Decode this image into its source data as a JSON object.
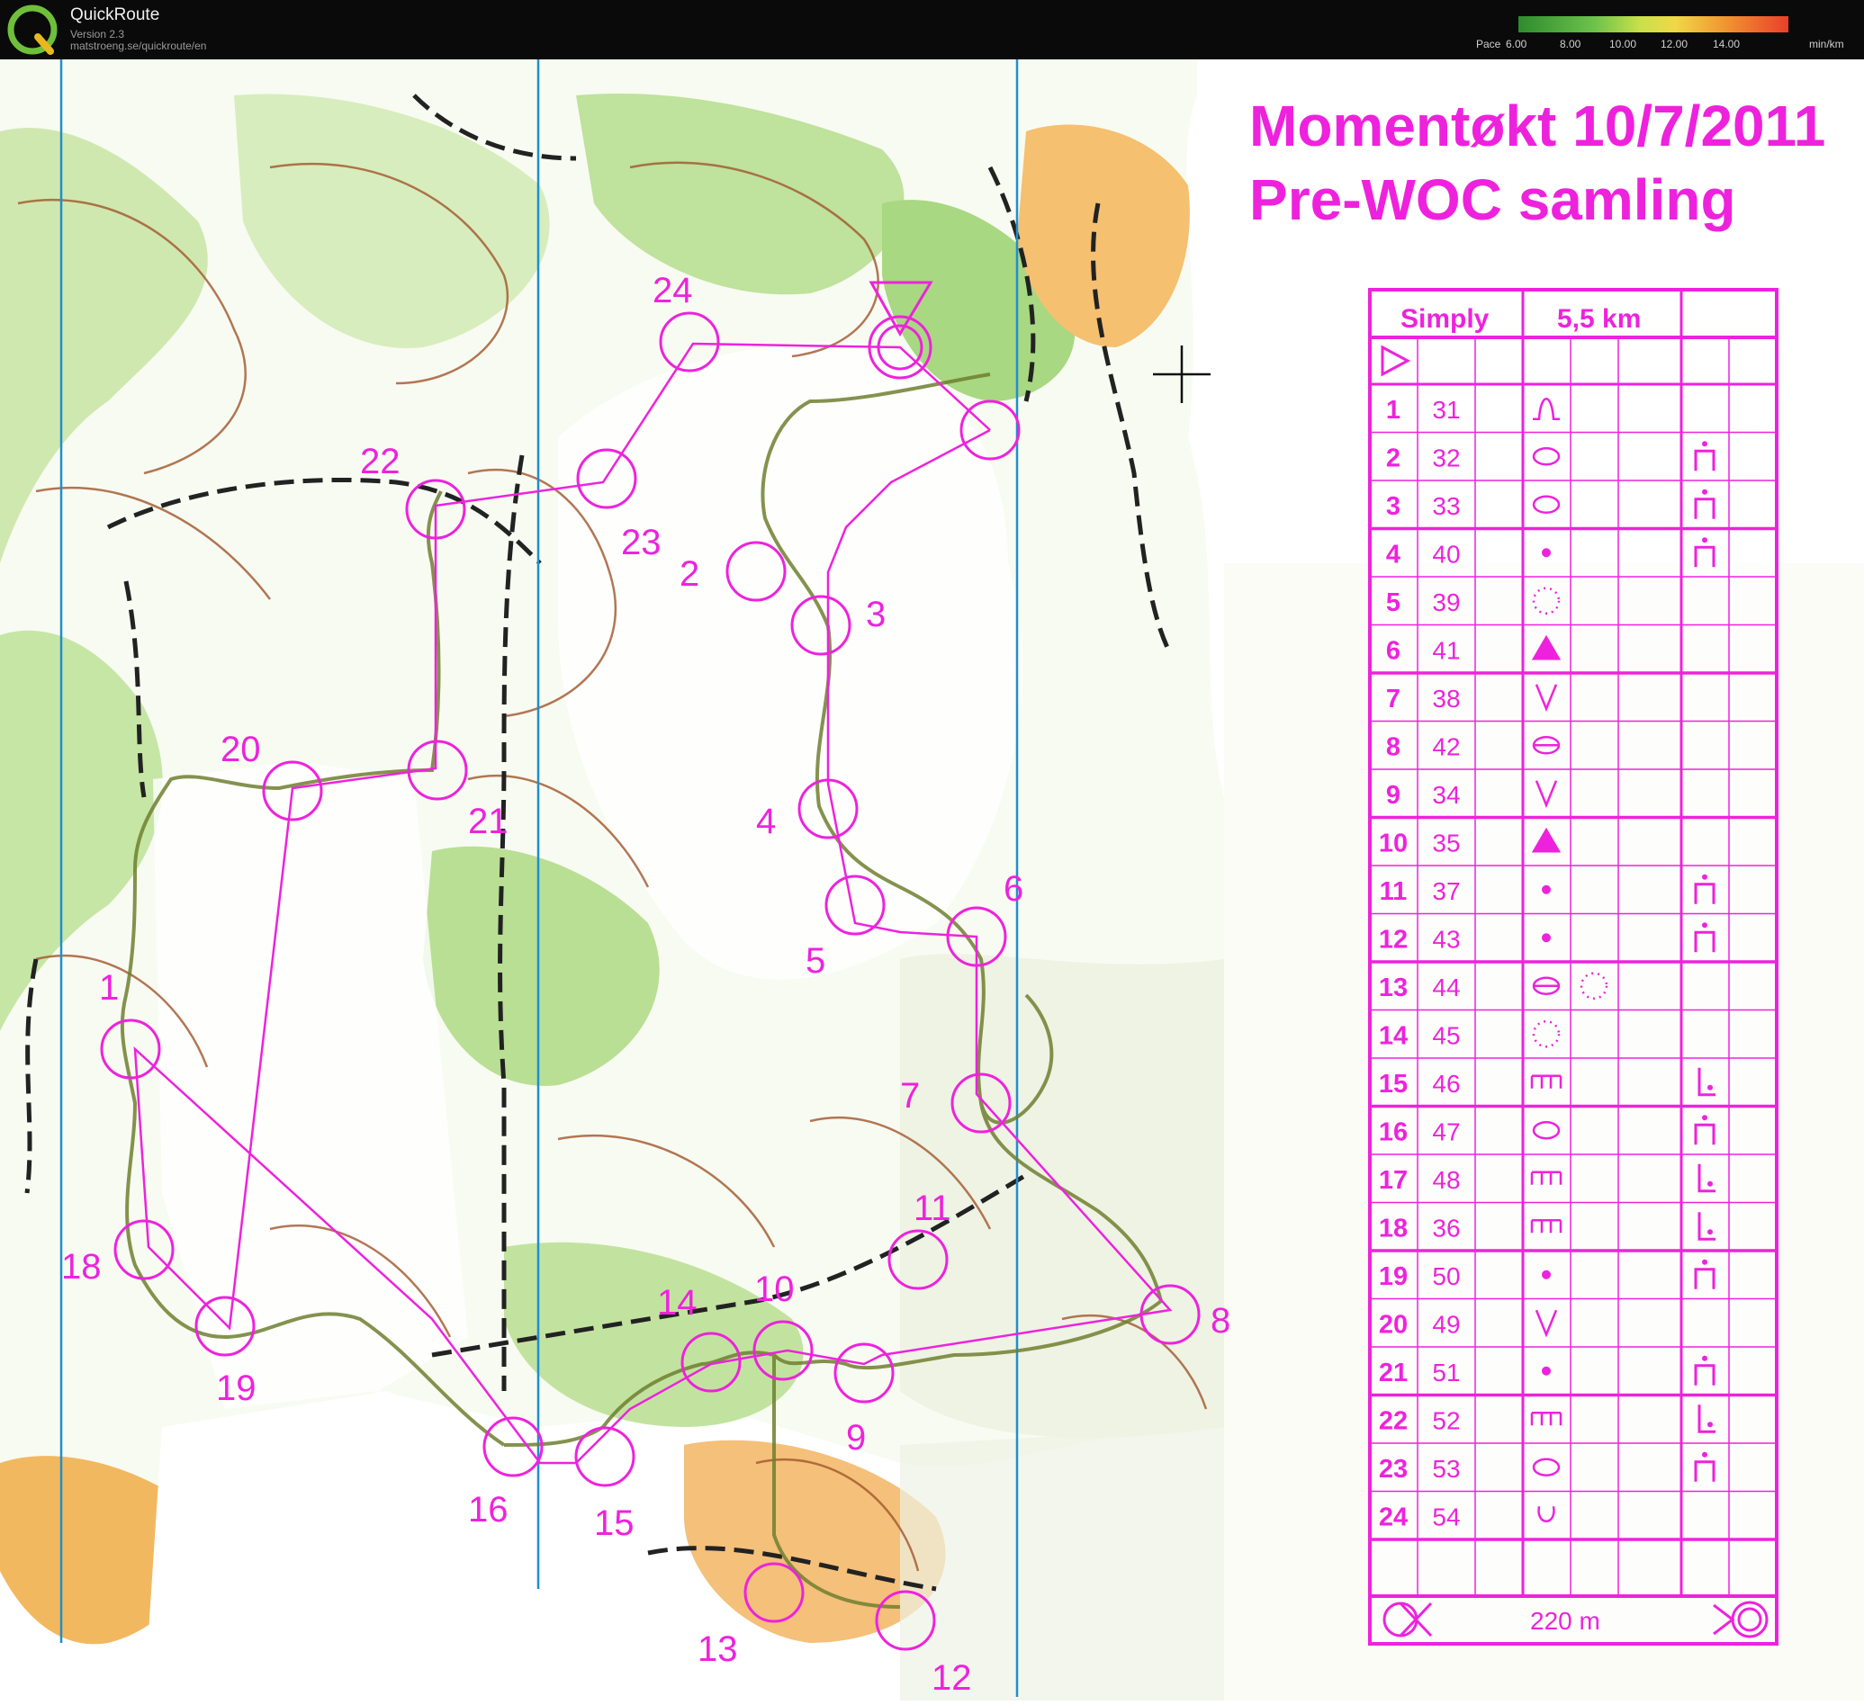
{
  "app": {
    "name": "QuickRoute",
    "version": "Version 2.3",
    "url": "matstroeng.se/quickroute/en",
    "pace_label": "Pace",
    "pace_ticks": [
      "6.00",
      "8.00",
      "10.00",
      "12.00",
      "14.00"
    ],
    "pace_unit": "min/km",
    "pace_colors": [
      "#2e8b2e",
      "#6cc24a",
      "#c8e04a",
      "#f0d848",
      "#f09030",
      "#e8402a"
    ]
  },
  "map": {
    "title_line1": "Momentøkt 10/7/2011",
    "title_line2": "Pre-WOC samling",
    "course_color": "#ee22dd",
    "route_color": "#7a8a3a",
    "meridian_color": "#1d8fd0",
    "controls": [
      {
        "num": "1"
      },
      {
        "num": "2"
      },
      {
        "num": "3"
      },
      {
        "num": "4"
      },
      {
        "num": "5"
      },
      {
        "num": "6"
      },
      {
        "num": "7"
      },
      {
        "num": "8"
      },
      {
        "num": "9"
      },
      {
        "num": "10"
      },
      {
        "num": "11"
      },
      {
        "num": "12"
      },
      {
        "num": "13"
      },
      {
        "num": "14"
      },
      {
        "num": "15"
      },
      {
        "num": "16"
      },
      {
        "num": "18"
      },
      {
        "num": "19"
      },
      {
        "num": "20"
      },
      {
        "num": "21"
      },
      {
        "num": "22"
      },
      {
        "num": "23"
      },
      {
        "num": "24"
      }
    ]
  },
  "description_sheet": {
    "course": "Simply",
    "length": "5,5 km",
    "finish_distance": "220 m",
    "rows": [
      {
        "num": "1",
        "code": "31",
        "feature": "knoll",
        "appearance": ""
      },
      {
        "num": "2",
        "code": "32",
        "feature": "depression",
        "appearance": "top"
      },
      {
        "num": "3",
        "code": "33",
        "feature": "depression",
        "appearance": "top"
      },
      {
        "num": "4",
        "code": "40",
        "feature": "dot",
        "appearance": "top"
      },
      {
        "num": "5",
        "code": "39",
        "feature": "dotted-circle",
        "appearance": ""
      },
      {
        "num": "6",
        "code": "41",
        "feature": "triangle",
        "appearance": ""
      },
      {
        "num": "7",
        "code": "38",
        "feature": "v",
        "appearance": ""
      },
      {
        "num": "8",
        "code": "42",
        "feature": "depression-line",
        "appearance": ""
      },
      {
        "num": "9",
        "code": "34",
        "feature": "v",
        "appearance": ""
      },
      {
        "num": "10",
        "code": "35",
        "feature": "triangle",
        "appearance": ""
      },
      {
        "num": "11",
        "code": "37",
        "feature": "dot",
        "appearance": "top"
      },
      {
        "num": "12",
        "code": "43",
        "feature": "dot",
        "appearance": "top"
      },
      {
        "num": "13",
        "code": "44",
        "feature": "depression-line",
        "appearance": "dotted-circle"
      },
      {
        "num": "14",
        "code": "45",
        "feature": "dotted-circle",
        "appearance": ""
      },
      {
        "num": "15",
        "code": "46",
        "feature": "comb",
        "appearance": "foot"
      },
      {
        "num": "16",
        "code": "47",
        "feature": "depression",
        "appearance": "top"
      },
      {
        "num": "17",
        "code": "48",
        "feature": "comb",
        "appearance": "foot"
      },
      {
        "num": "18",
        "code": "36",
        "feature": "comb",
        "appearance": "foot"
      },
      {
        "num": "19",
        "code": "50",
        "feature": "dot",
        "appearance": "top"
      },
      {
        "num": "20",
        "code": "49",
        "feature": "v",
        "appearance": ""
      },
      {
        "num": "21",
        "code": "51",
        "feature": "dot",
        "appearance": "top"
      },
      {
        "num": "22",
        "code": "52",
        "feature": "comb",
        "appearance": "foot"
      },
      {
        "num": "23",
        "code": "53",
        "feature": "depression",
        "appearance": "top"
      },
      {
        "num": "24",
        "code": "54",
        "feature": "pit",
        "appearance": ""
      }
    ]
  }
}
